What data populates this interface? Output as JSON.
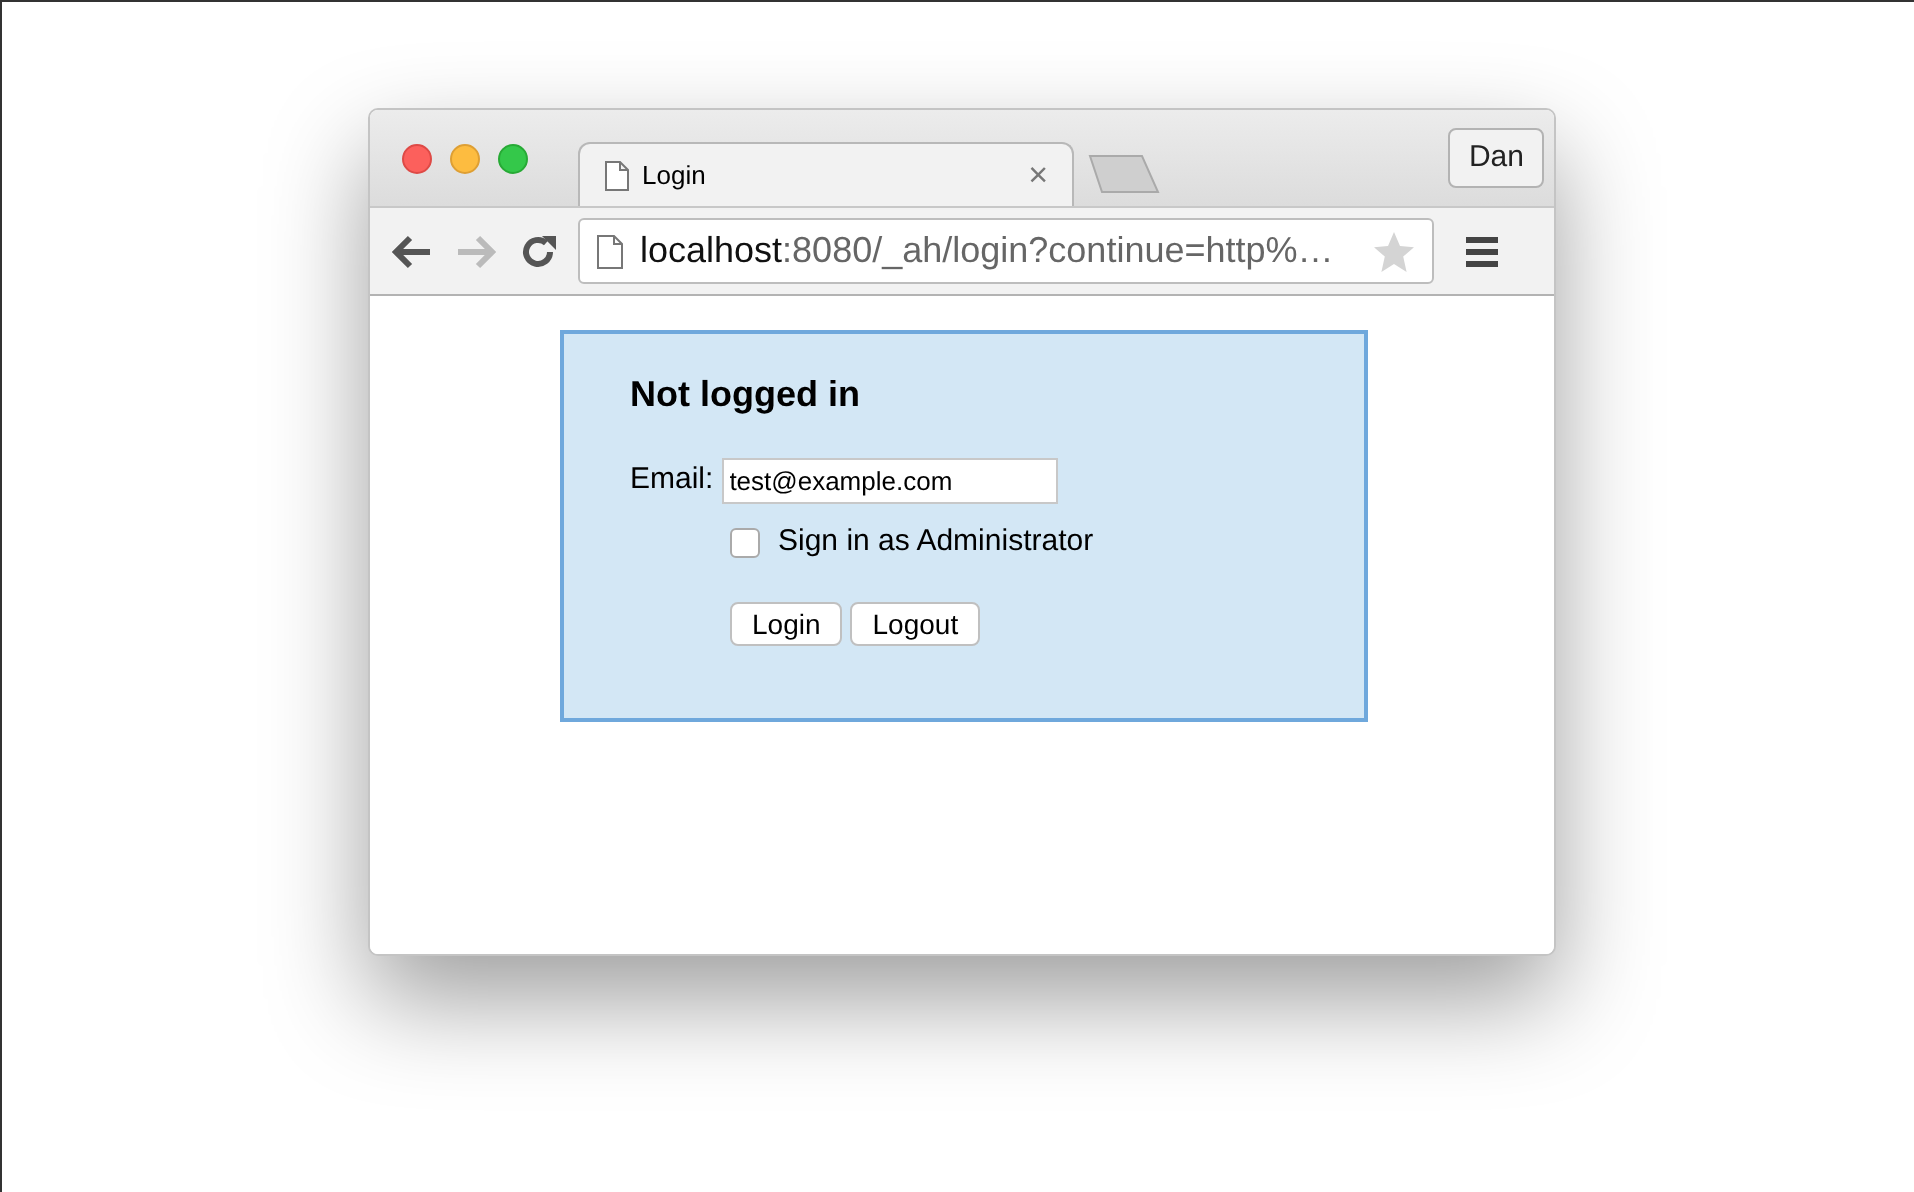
{
  "window": {
    "tab": {
      "title": "Login",
      "close": "×",
      "selected": true
    },
    "profile": "Dan"
  },
  "toolbar": {
    "url": {
      "host": "localhost",
      "rest": ":8080/_ah/login?continue=http%…"
    }
  },
  "login": {
    "heading": "Not logged in",
    "email_label": "Email:",
    "email_value": "test@example.com",
    "admin": {
      "label": "Sign in as Administrator",
      "checked": false
    },
    "buttons": [
      "Login",
      "Logout"
    ]
  }
}
